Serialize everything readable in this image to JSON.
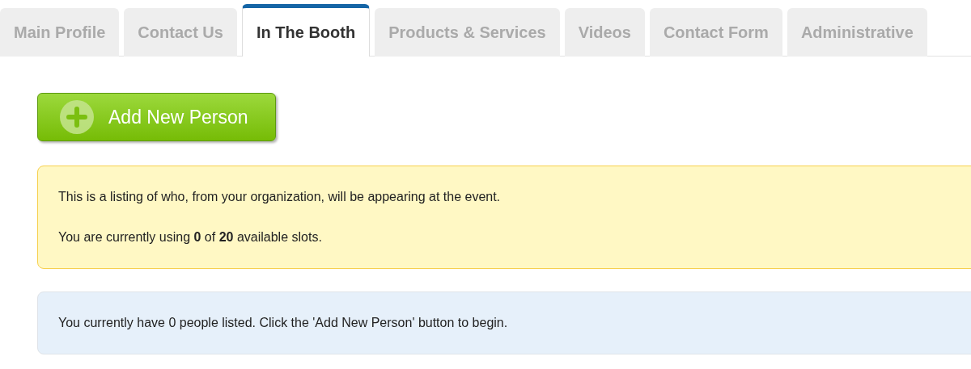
{
  "tabs": [
    {
      "label": "Main Profile",
      "selected": false
    },
    {
      "label": "Contact Us",
      "selected": false
    },
    {
      "label": "In The Booth",
      "selected": true
    },
    {
      "label": "Products & Services",
      "selected": false
    },
    {
      "label": "Videos",
      "selected": false
    },
    {
      "label": "Contact Form",
      "selected": false
    },
    {
      "label": "Administrative",
      "selected": false
    }
  ],
  "add_button": {
    "label": "Add New Person"
  },
  "notice": {
    "lines": [
      "This is a listing of who, from your organization, will be appearing at the event.",
      "You are currently using **0** of **20** available slots."
    ]
  },
  "info": {
    "text": "You currently have 0 people listed. Click the 'Add New Person' button to begin."
  }
}
